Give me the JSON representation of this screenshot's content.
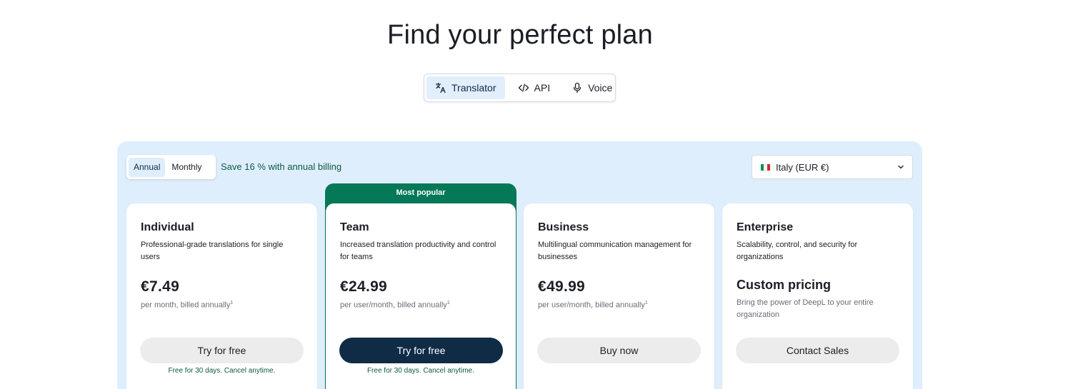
{
  "page_title": "Find your perfect plan",
  "product_tabs": [
    {
      "label": "Translator",
      "icon": "translate-icon",
      "active": true
    },
    {
      "label": "API",
      "icon": "code-icon",
      "active": false
    },
    {
      "label": "Voice",
      "icon": "microphone-icon",
      "active": false
    }
  ],
  "billing": {
    "annual_label": "Annual",
    "monthly_label": "Monthly",
    "selected": "Annual",
    "save_note": "Save 16 % with annual billing"
  },
  "region": {
    "selected": "Italy (EUR €)",
    "flag_colors": [
      "#009246",
      "#ffffff",
      "#ce2b37"
    ]
  },
  "popular_badge": "Most popular",
  "plans": [
    {
      "name": "Individual",
      "description": "Professional-grade translations for single users",
      "price": "€7.49",
      "price_note": "per month, billed annually",
      "footnote": "1",
      "cta": "Try for free",
      "trial_note": "Free for 30 days. Cancel anytime."
    },
    {
      "name": "Team",
      "description": "Increased translation productivity and control for teams",
      "price": "€24.99",
      "price_note": "per user/month, billed annually",
      "footnote": "1",
      "cta": "Try for free",
      "trial_note": "Free for 30 days. Cancel anytime."
    },
    {
      "name": "Business",
      "description": "Multilingual communication management for businesses",
      "price": "€49.99",
      "price_note": "per user/month, billed annually",
      "footnote": "1",
      "cta": "Buy now"
    },
    {
      "name": "Enterprise",
      "description": "Scalability, control, and security for organizations",
      "price": "Custom pricing",
      "price_note": "Bring the power of DeepL to your entire organization",
      "cta": "Contact Sales"
    }
  ],
  "colors": {
    "accent_green": "#047857",
    "primary_dark": "#0f2b46",
    "panel_bg": "#dfeefc"
  }
}
